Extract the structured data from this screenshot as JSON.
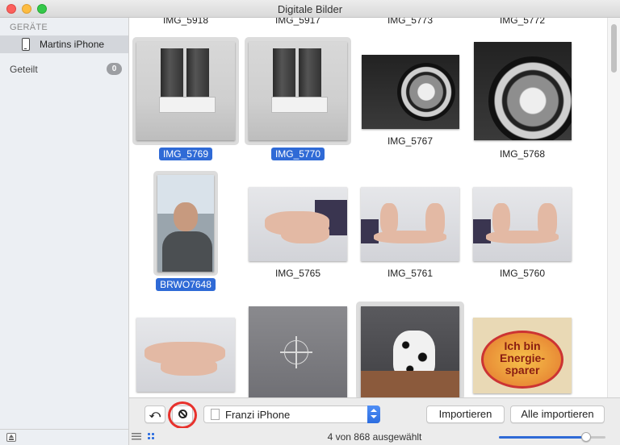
{
  "window": {
    "title": "Digitale Bilder"
  },
  "sidebar": {
    "section_devices": "GERÄTE",
    "device_name": "Martins iPhone",
    "shared_label": "Geteilt",
    "shared_count": "0"
  },
  "grid": {
    "top_partial_captions": [
      "IMG_5918",
      "IMG_5917",
      "IMG_5773",
      "IMG_5772"
    ],
    "items": [
      {
        "caption": "IMG_5769",
        "selected": true
      },
      {
        "caption": "IMG_5770",
        "selected": true
      },
      {
        "caption": "IMG_5767",
        "selected": false
      },
      {
        "caption": "IMG_5768",
        "selected": false
      },
      {
        "caption": "BRWO7648",
        "selected": true
      },
      {
        "caption": "IMG_5765",
        "selected": false
      },
      {
        "caption": "IMG_5761",
        "selected": false
      },
      {
        "caption": "IMG_5760",
        "selected": false
      },
      {
        "caption": "",
        "selected": false
      },
      {
        "caption": "",
        "selected": false
      },
      {
        "caption": "",
        "selected": true
      },
      {
        "caption": "",
        "selected": false
      }
    ],
    "sticker_text": "Ich bin Energie- sparer"
  },
  "toolbar": {
    "rotate_icon": "rotate-left-icon",
    "delete_icon": "no-entry-icon",
    "destination_label": "Franzi iPhone",
    "import_label": "Importieren",
    "import_all_label": "Alle importieren"
  },
  "status": {
    "text": "4 von 868 ausgewählt",
    "zoom_level": 0.82
  },
  "colors": {
    "selection": "#2f6ad6",
    "annotation_ring": "#e8322d"
  }
}
